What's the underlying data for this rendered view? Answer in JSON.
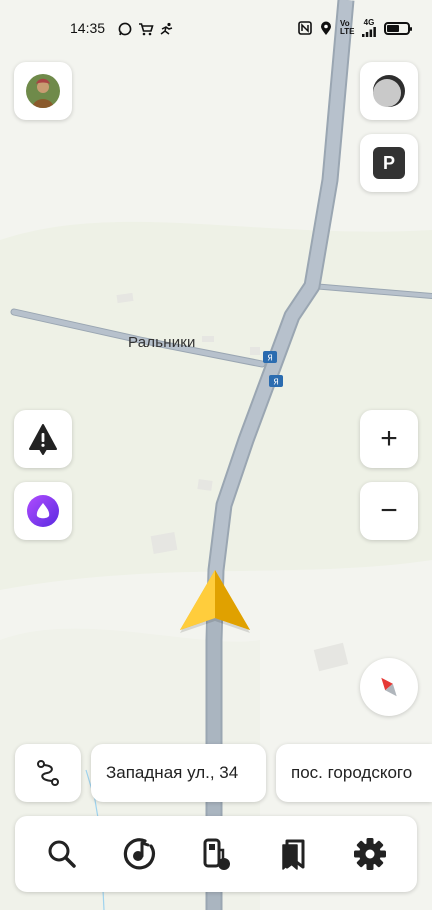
{
  "status_bar": {
    "time": "14:35",
    "left_icons": [
      "whatsapp-icon",
      "shopping-cart-icon",
      "running-person-icon"
    ],
    "right_icons": [
      "nfc-icon",
      "location-icon",
      "volte-icon",
      "signal-4g-icon",
      "battery-icon"
    ],
    "volte_text": "Vo LTE",
    "net_text": "4G",
    "battery_level": 0.55
  },
  "map": {
    "place_label": "Ральники",
    "road_color": "#b7c1cc",
    "road_edge_color": "#9aa6b2",
    "background_color": "#f3f4ef",
    "route_shield_icon": "highway-shield-icon"
  },
  "controls": {
    "profile": "avatar",
    "layers_icon": "map-layers-icon",
    "parking_label": "P",
    "alert_icon": "road-alert-icon",
    "assistant_icon": "alice-assistant-icon",
    "zoom_in_label": "+",
    "zoom_out_label": "−",
    "compass_icon": "compass-icon"
  },
  "address_bar": {
    "route_icon": "route-icon",
    "current_street": "Западная ул., 34",
    "next_place": "пос. городского"
  },
  "toolbar": {
    "items": [
      {
        "name": "search",
        "icon": "search-icon"
      },
      {
        "name": "music",
        "icon": "music-icon"
      },
      {
        "name": "fuel",
        "icon": "gas-station-icon"
      },
      {
        "name": "bookmarks",
        "icon": "bookmark-icon"
      },
      {
        "name": "settings",
        "icon": "gear-icon"
      }
    ]
  },
  "colors": {
    "accent_arrow": "#f5b400",
    "assistant_purple": "#7b2ff7",
    "compass_red": "#e53935"
  }
}
